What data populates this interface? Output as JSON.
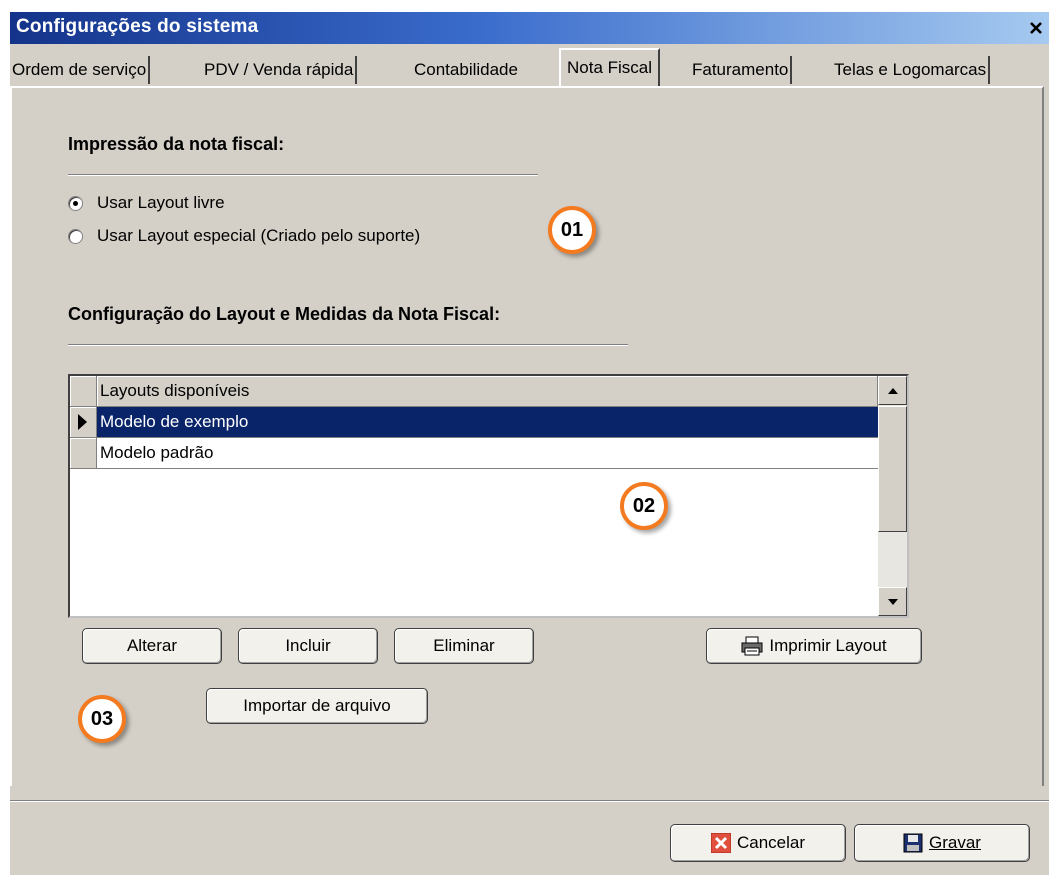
{
  "window": {
    "title": "Configurações do sistema",
    "close_label": "×"
  },
  "tabs": [
    {
      "label": "Ordem de serviço"
    },
    {
      "label": "PDV / Venda rápida"
    },
    {
      "label": "Contabilidade"
    },
    {
      "label": "Nota Fiscal",
      "active": true
    },
    {
      "label": "Faturamento"
    },
    {
      "label": "Telas e Logomarcas"
    }
  ],
  "print_section": {
    "heading": "Impressão da nota fiscal:",
    "options": [
      {
        "label": "Usar Layout livre",
        "checked": true
      },
      {
        "label": "Usar Layout especial (Criado pelo suporte)",
        "checked": false
      }
    ]
  },
  "layout_section": {
    "heading": "Configuração do Layout e Medidas da Nota Fiscal:",
    "grid": {
      "column": "Layouts disponíveis",
      "rows": [
        "Modelo de exemplo",
        "Modelo padrão"
      ],
      "selected_index": 0
    }
  },
  "buttons": {
    "alterar": "Alterar",
    "incluir": "Incluir",
    "eliminar": "Eliminar",
    "imprimir": "Imprimir Layout",
    "importar": "Importar de arquivo",
    "cancelar": "Cancelar",
    "gravar": "Gravar"
  },
  "badges": [
    "01",
    "02",
    "03"
  ],
  "colors": {
    "title_gradient_start": "#14338a",
    "selection": "#0a246a",
    "badge_ring": "#f47a20",
    "window_face": "#d4d0c8"
  }
}
